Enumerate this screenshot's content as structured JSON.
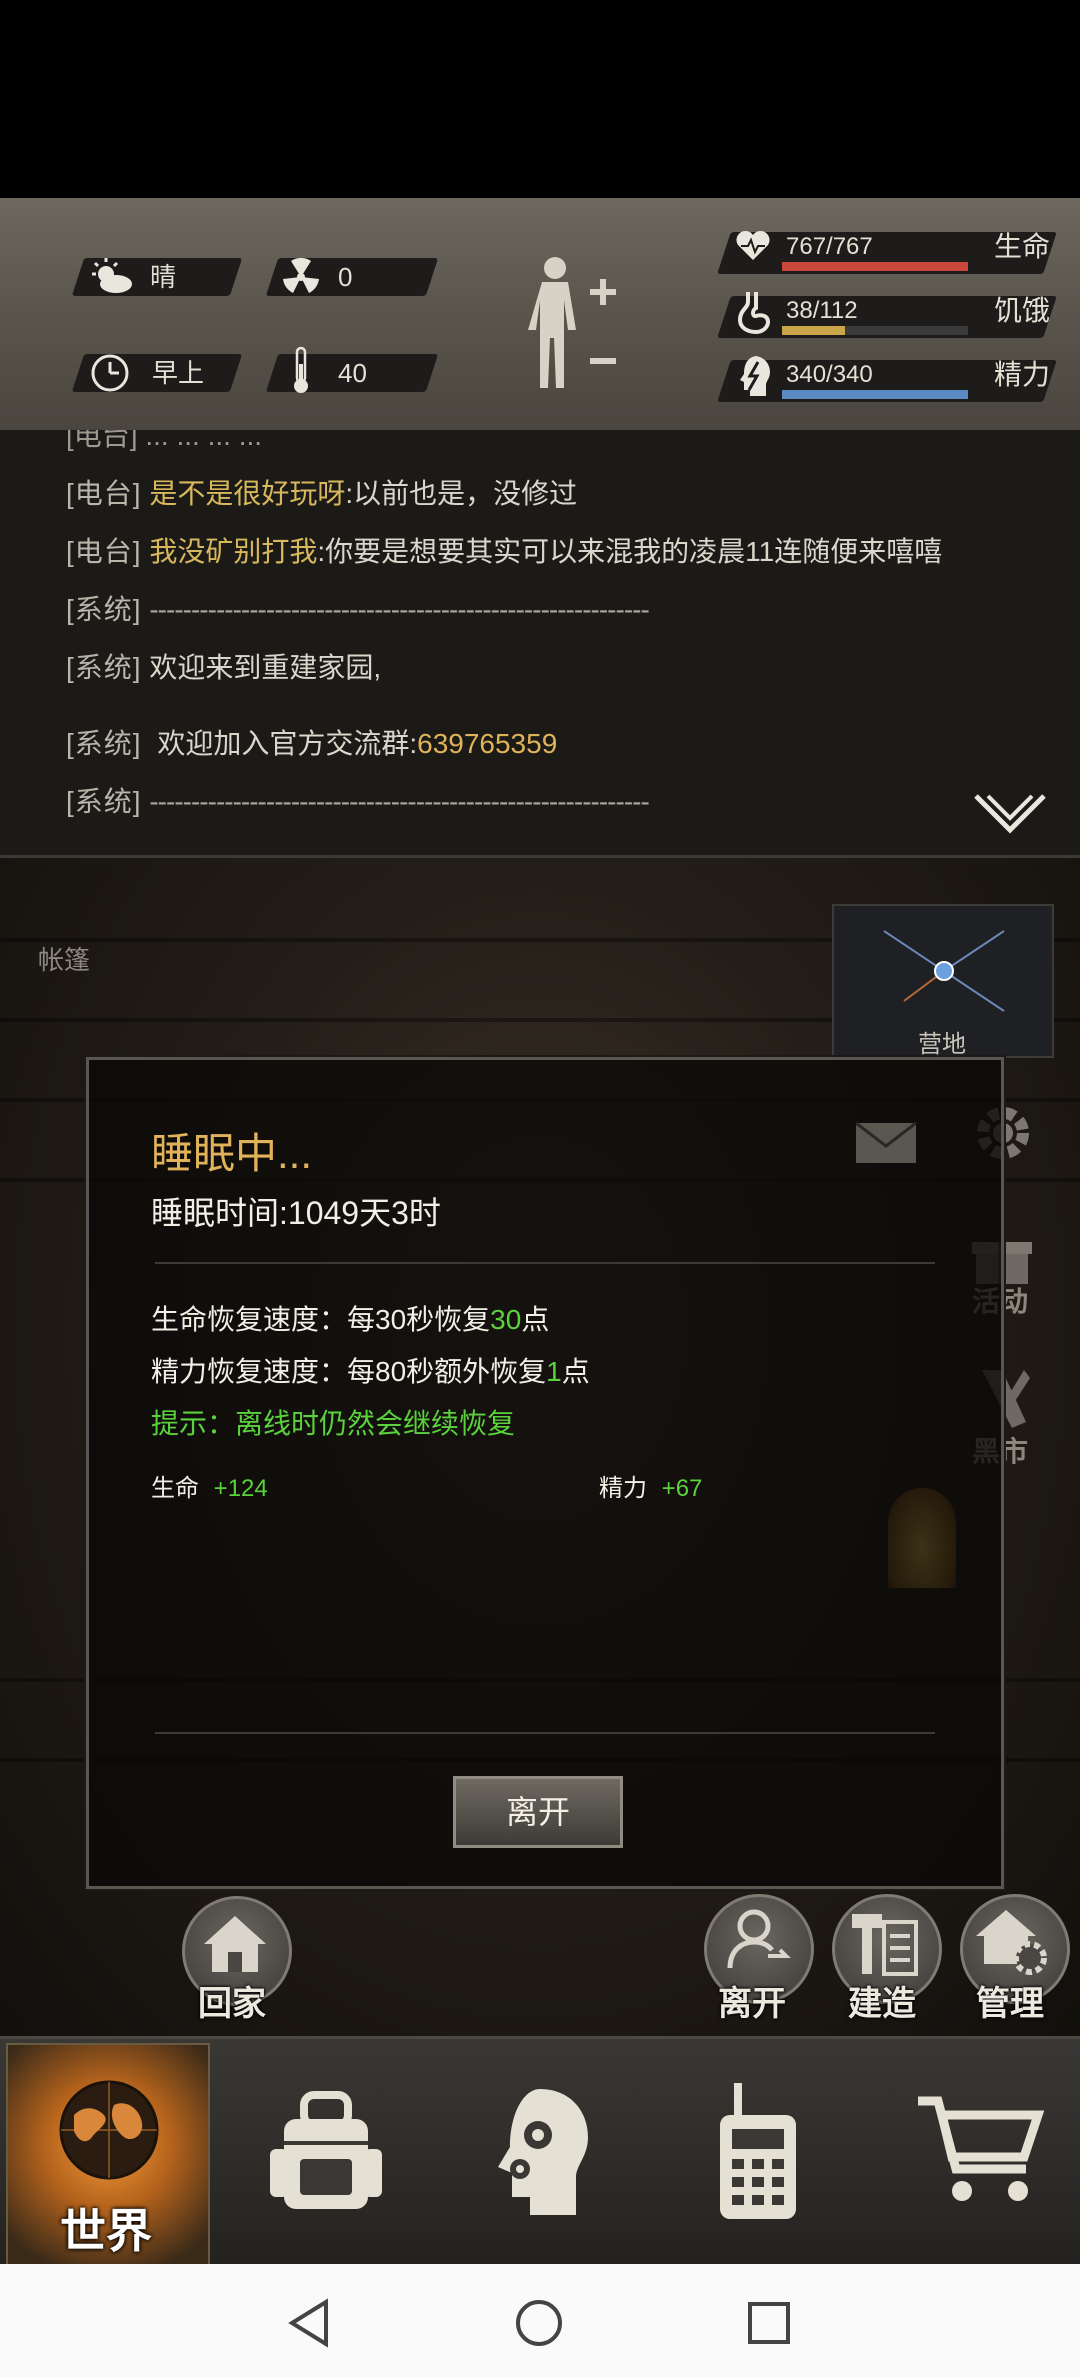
{
  "status": {
    "weather": "晴",
    "radiation": "0",
    "time_of_day": "早上",
    "temperature": "40",
    "health": {
      "label": "生命",
      "value": "767/767",
      "fraction": 1.0,
      "color": "#c8463a"
    },
    "hunger": {
      "label": "饥饿",
      "value": "38/112",
      "fraction": 0.34,
      "color": "#c9a64a"
    },
    "energy": {
      "label": "精力",
      "value": "340/340",
      "fraction": 1.0,
      "color": "#5a8bc4"
    }
  },
  "chat": {
    "partial_top": "[电台] ... ... ... ...",
    "lines": [
      {
        "tag": "[电台]",
        "user": "是不是很好玩呀",
        "text": ":以前也是，没修过"
      },
      {
        "tag": "[电台]",
        "user": "我没矿别打我",
        "text": ":你要是想要其实可以来混我的凌晨11连随便来嘻嘻"
      },
      {
        "tag": "[系统]",
        "text": "------------------------------------------------------------"
      },
      {
        "tag": "[系统]",
        "text": "欢迎来到重建家园,"
      },
      {
        "tag": "[系统]",
        "text": "欢迎加入官方交流群:",
        "highlight": "639765359"
      },
      {
        "tag": "[系统]",
        "text": "------------------------------------------------------------"
      }
    ]
  },
  "scene": {
    "location": "帐篷",
    "camp_label": "营地",
    "side_activity": "活动",
    "side_market": "黑市"
  },
  "dialog": {
    "title": "睡眠中...",
    "sleep_time": "睡眠时间:1049天3时",
    "hp_regen_prefix": "生命恢复速度：每30秒恢复",
    "hp_regen_value": "30",
    "hp_regen_suffix": "点",
    "energy_regen_prefix": "精力恢复速度：每80秒额外恢复",
    "energy_regen_value": "1",
    "energy_regen_suffix": "点",
    "hint": "提示：离线时仍然会继续恢复",
    "hp_gain_label": "生命",
    "hp_gain_value": "+124",
    "energy_gain_label": "精力",
    "energy_gain_value": "+67",
    "leave_button": "离开"
  },
  "actions": {
    "home": "回家",
    "leave": "离开",
    "build": "建造",
    "manage": "管理"
  },
  "nav": {
    "world": "世界"
  },
  "colors": {
    "accent_gold": "#e0b259",
    "green": "#5ad23c",
    "orange": "#f19a3a"
  }
}
